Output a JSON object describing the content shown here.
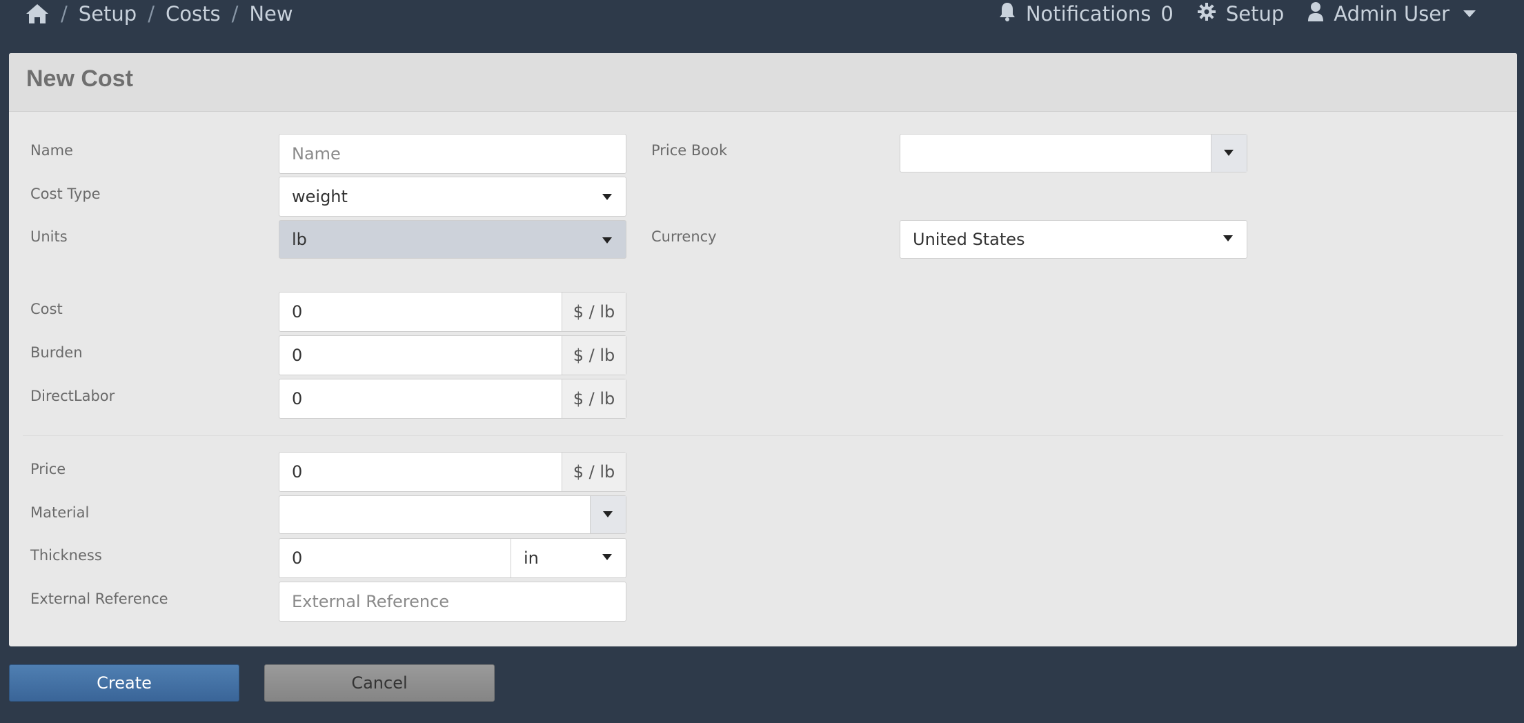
{
  "breadcrumb": {
    "items": [
      "Setup",
      "Costs",
      "New"
    ],
    "separator": "/"
  },
  "header": {
    "notifications_label": "Notifications",
    "notifications_count": "0",
    "setup_label": "Setup",
    "user_label": "Admin User"
  },
  "panel": {
    "title": "New Cost"
  },
  "form": {
    "name": {
      "label": "Name",
      "placeholder": "Name",
      "value": ""
    },
    "cost_type": {
      "label": "Cost Type",
      "value": "weight"
    },
    "units": {
      "label": "Units",
      "value": "lb"
    },
    "price_book": {
      "label": "Price Book",
      "value": ""
    },
    "currency": {
      "label": "Currency",
      "value": "United States"
    },
    "cost": {
      "label": "Cost",
      "value": "0",
      "unit": "$ / lb"
    },
    "burden": {
      "label": "Burden",
      "value": "0",
      "unit": "$ / lb"
    },
    "direct_labor": {
      "label": "DirectLabor",
      "value": "0",
      "unit": "$ / lb"
    },
    "price": {
      "label": "Price",
      "value": "0",
      "unit": "$ / lb"
    },
    "material": {
      "label": "Material",
      "value": ""
    },
    "thickness": {
      "label": "Thickness",
      "value": "0",
      "unit": "in"
    },
    "external_reference": {
      "label": "External Reference",
      "placeholder": "External Reference",
      "value": ""
    }
  },
  "actions": {
    "create_label": "Create",
    "cancel_label": "Cancel"
  },
  "colors": {
    "background": "#2e3a4a",
    "panel": "#e8e8e8",
    "primary": "#3a6598",
    "secondary": "#8c8c8c"
  }
}
